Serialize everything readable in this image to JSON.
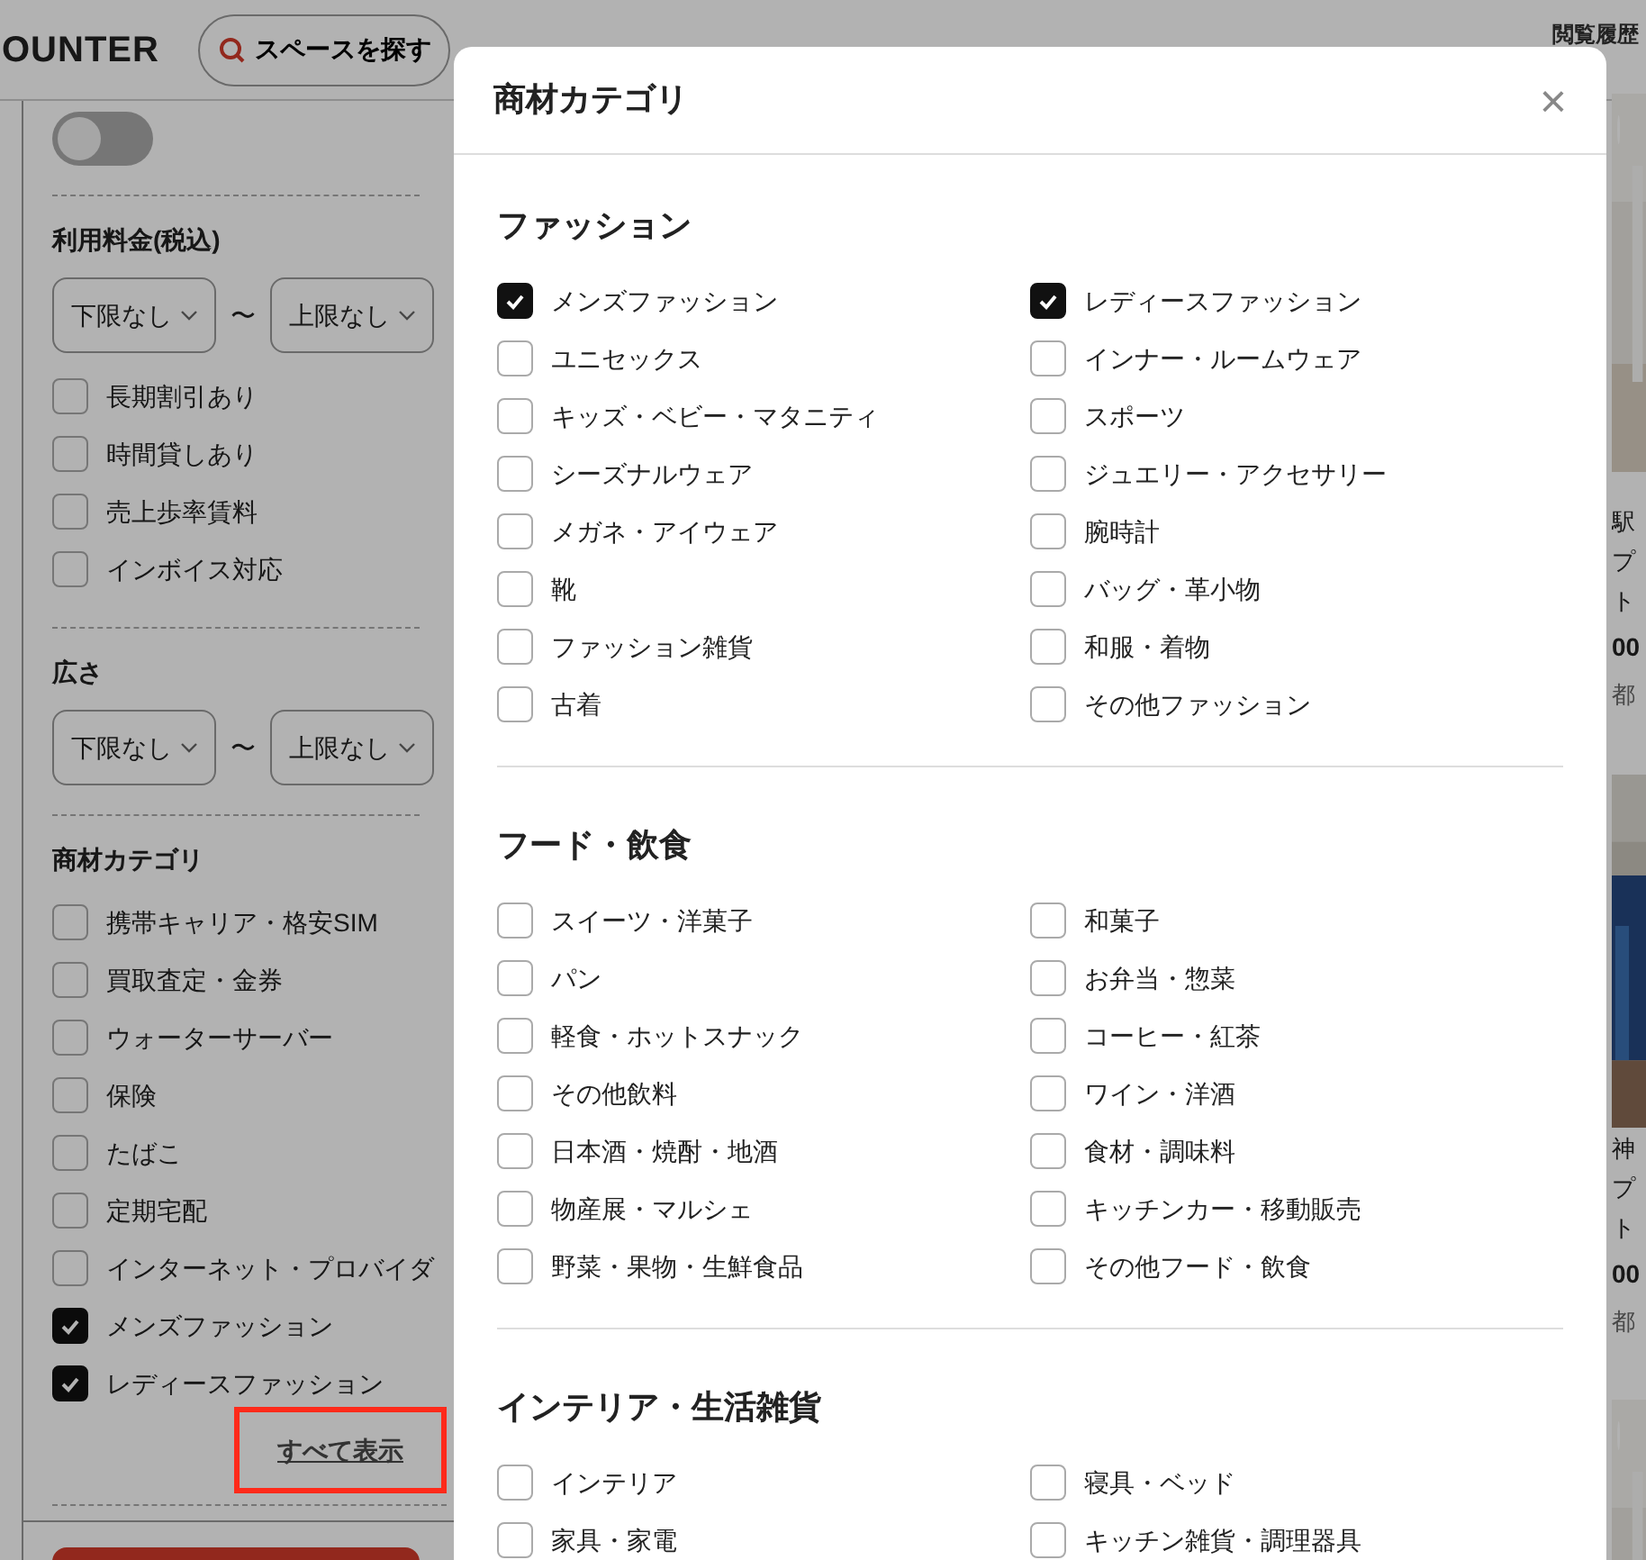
{
  "header": {
    "logo_text": "OUNTER",
    "search_button": "スペースを探す",
    "history_link": "閲覧履歴"
  },
  "sidebar": {
    "toggle": {
      "on": false
    },
    "price": {
      "title": "利用料金(税込)",
      "min_select": "下限なし",
      "separator": "〜",
      "max_select": "上限なし",
      "options": [
        {
          "label": "長期割引あり",
          "checked": false
        },
        {
          "label": "時間貸しあり",
          "checked": false
        },
        {
          "label": "売上歩率賃料",
          "checked": false
        },
        {
          "label": "インボイス対応",
          "checked": false
        }
      ]
    },
    "area": {
      "title": "広さ",
      "min_select": "下限なし",
      "separator": "〜",
      "max_select": "上限なし"
    },
    "category": {
      "title": "商材カテゴリ",
      "options": [
        {
          "label": "携帯キャリア・格安SIM",
          "checked": false
        },
        {
          "label": "買取査定・金券",
          "checked": false
        },
        {
          "label": "ウォーターサーバー",
          "checked": false
        },
        {
          "label": "保険",
          "checked": false
        },
        {
          "label": "たばこ",
          "checked": false
        },
        {
          "label": "定期宅配",
          "checked": false
        },
        {
          "label": "インターネット・プロバイダ",
          "checked": false
        },
        {
          "label": "メンズファッション",
          "checked": true
        },
        {
          "label": "レディースファッション",
          "checked": true
        }
      ],
      "show_all_link": "すべて表示",
      "highlighted": true
    }
  },
  "listings": [
    {
      "kind": "picture",
      "title_lines": [
        "駅",
        "プ",
        "ト"
      ],
      "price": "00",
      "location": "都"
    },
    {
      "kind": "picture",
      "title_lines": [
        "神",
        "プ",
        "ト"
      ],
      "price": "00",
      "location": "都"
    },
    {
      "kind": "picture"
    }
  ],
  "modal": {
    "title": "商材カテゴリ",
    "close": "×",
    "sections": [
      {
        "title": "ファッション",
        "items": [
          {
            "label": "メンズファッション",
            "checked": true
          },
          {
            "label": "レディースファッション",
            "checked": true
          },
          {
            "label": "ユニセックス",
            "checked": false
          },
          {
            "label": "インナー・ルームウェア",
            "checked": false
          },
          {
            "label": "キッズ・ベビー・マタニティ",
            "checked": false
          },
          {
            "label": "スポーツ",
            "checked": false
          },
          {
            "label": "シーズナルウェア",
            "checked": false
          },
          {
            "label": "ジュエリー・アクセサリー",
            "checked": false
          },
          {
            "label": "メガネ・アイウェア",
            "checked": false
          },
          {
            "label": "腕時計",
            "checked": false
          },
          {
            "label": "靴",
            "checked": false
          },
          {
            "label": "バッグ・革小物",
            "checked": false
          },
          {
            "label": "ファッション雑貨",
            "checked": false
          },
          {
            "label": "和服・着物",
            "checked": false
          },
          {
            "label": "古着",
            "checked": false
          },
          {
            "label": "その他ファッション",
            "checked": false
          }
        ]
      },
      {
        "title": "フード・飲食",
        "items": [
          {
            "label": "スイーツ・洋菓子",
            "checked": false
          },
          {
            "label": "和菓子",
            "checked": false
          },
          {
            "label": "パン",
            "checked": false
          },
          {
            "label": "お弁当・惣菜",
            "checked": false
          },
          {
            "label": "軽食・ホットスナック",
            "checked": false
          },
          {
            "label": "コーヒー・紅茶",
            "checked": false
          },
          {
            "label": "その他飲料",
            "checked": false
          },
          {
            "label": "ワイン・洋酒",
            "checked": false
          },
          {
            "label": "日本酒・焼酎・地酒",
            "checked": false
          },
          {
            "label": "食材・調味料",
            "checked": false
          },
          {
            "label": "物産展・マルシェ",
            "checked": false
          },
          {
            "label": "キッチンカー・移動販売",
            "checked": false
          },
          {
            "label": "野菜・果物・生鮮食品",
            "checked": false
          },
          {
            "label": "その他フード・飲食",
            "checked": false
          }
        ]
      },
      {
        "title": "インテリア・生活雑貨",
        "items": [
          {
            "label": "インテリア",
            "checked": false
          },
          {
            "label": "寝具・ベッド",
            "checked": false
          },
          {
            "label": "家具・家電",
            "checked": false
          },
          {
            "label": "キッチン雑貨・調理器具",
            "checked": false
          }
        ]
      }
    ]
  }
}
